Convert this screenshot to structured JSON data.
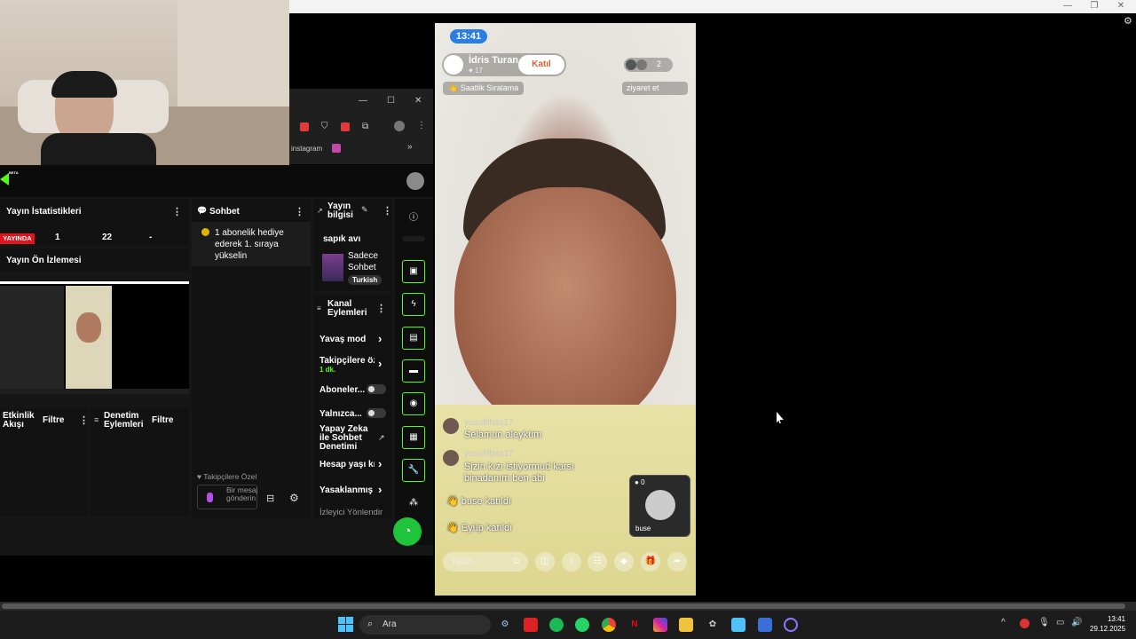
{
  "window": {
    "minimize_glyph": "—",
    "restore_glyph": "❐",
    "close_glyph": "✕"
  },
  "browser": {
    "bookmark_instagram": "instagram",
    "more_bookmarks": "»",
    "min": "—",
    "max": "☐",
    "close": "✕"
  },
  "dash": {
    "beta_badge": "BETA",
    "stats_title": "Yayın İstatistikleri",
    "live_badge": "YAYINDA",
    "stat_1": "1",
    "stat_2": "22",
    "stat_3": "-",
    "preview_title": "Yayın Ön İzlemesi",
    "activity_title": "Etkinlik Akışı",
    "activity_filter": "Filtre",
    "moderation_title": "Denetim Eylemleri",
    "moderation_filter": "Filtre",
    "chat_title": "Sohbet",
    "chat_msg": "1 abonelik hediye ederek 1. sıraya yükselin",
    "chat_followers_only": "Takipçilere Özel",
    "chat_input_placeholder": "Bir mesaj gönderin",
    "stream_info_title": "Yayın bilgisi",
    "stream_title": "sapık avı",
    "category": "Sadece Sohbet",
    "language_tag": "Turkish",
    "channel_actions_title": "Kanal Eylemleri",
    "actions": [
      {
        "label": "Yavaş mod"
      },
      {
        "label": "Takipçilere öz",
        "sub": "1 dk."
      },
      {
        "label": "Aboneler..."
      },
      {
        "label": "Yalnızca..."
      },
      {
        "label": "Yapay Zeka ile Sohbet Denetimi"
      },
      {
        "label": "Hesap yaşı kı"
      },
      {
        "label": "Yasaklanmış i"
      },
      {
        "label": "İzleyici Yönlendir"
      }
    ],
    "accent": "#53fc18"
  },
  "phone": {
    "time": "13:41",
    "host_name": "İdris Turan",
    "host_likes": "17",
    "join_label": "Katıl",
    "viewer_count": "2",
    "hourly_rank": "Saatlik Sıralama",
    "visit_label": "ziyaret et",
    "comments": [
      {
        "user": "yusufilbas17",
        "text": "Selamun aleyküm"
      },
      {
        "user": "yusufilbas17",
        "text": "Sizin kızı istiyormud karsı binadanım ben abi"
      }
    ],
    "joins": [
      {
        "text": "buse katıldı"
      },
      {
        "text": "Eyüp katıldı"
      }
    ],
    "guest_name": "buse",
    "guest_count": "0",
    "input_placeholder": "Yazın..."
  },
  "taskbar": {
    "search_label": "Ara",
    "clock_time": "13:41",
    "clock_date": "29.12.2025"
  }
}
